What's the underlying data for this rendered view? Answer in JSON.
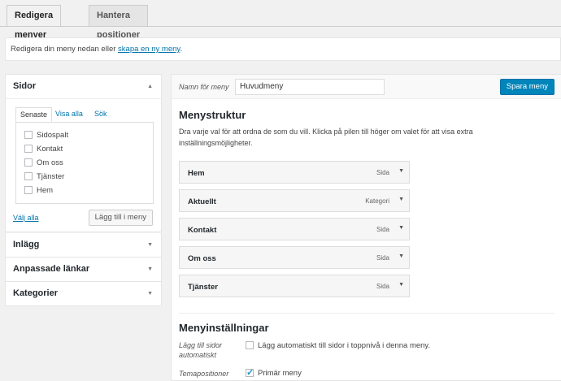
{
  "tabs": {
    "edit": "Redigera menyer",
    "manage": "Hantera positioner"
  },
  "notice": {
    "text": "Redigera din meny nedan eller",
    "link": "skapa en ny meny",
    "end": "."
  },
  "pages_box": {
    "title": "Sidor",
    "tabs": [
      "Senaste",
      "Visa alla",
      "Sök"
    ],
    "items": [
      "Sidospalt",
      "Kontakt",
      "Om oss",
      "Tjänster",
      "Hem"
    ],
    "select_all": "Välj alla",
    "add_button": "Lägg till i meny"
  },
  "collapsed_boxes": [
    "Inlägg",
    "Anpassade länkar",
    "Kategorier"
  ],
  "menu": {
    "name_label": "Namn för meny",
    "name_value": "Huvudmeny",
    "save_button": "Spara meny",
    "structure_title": "Menystruktur",
    "structure_desc": "Dra varje val för att ordna de som du vill. Klicka på pilen till höger om valet för att visa extra inställningsmöjligheter.",
    "items": [
      {
        "title": "Hem",
        "type": "Sida"
      },
      {
        "title": "Aktuellt",
        "type": "Kategori"
      },
      {
        "title": "Kontakt",
        "type": "Sida"
      },
      {
        "title": "Om oss",
        "type": "Sida"
      },
      {
        "title": "Tjänster",
        "type": "Sida"
      }
    ],
    "settings_title": "Menyinställningar",
    "auto_add_label": "Lägg till sidor automatiskt",
    "auto_add_text": "Lägg automatiskt till sidor i toppnivå i denna meny.",
    "theme_label": "Temapositioner",
    "theme_text": "Primär meny"
  },
  "icons": {
    "collapse_up": "▲",
    "expand_down": "▼"
  },
  "colors": {
    "accent": "#0085ba",
    "link": "#0073aa"
  }
}
